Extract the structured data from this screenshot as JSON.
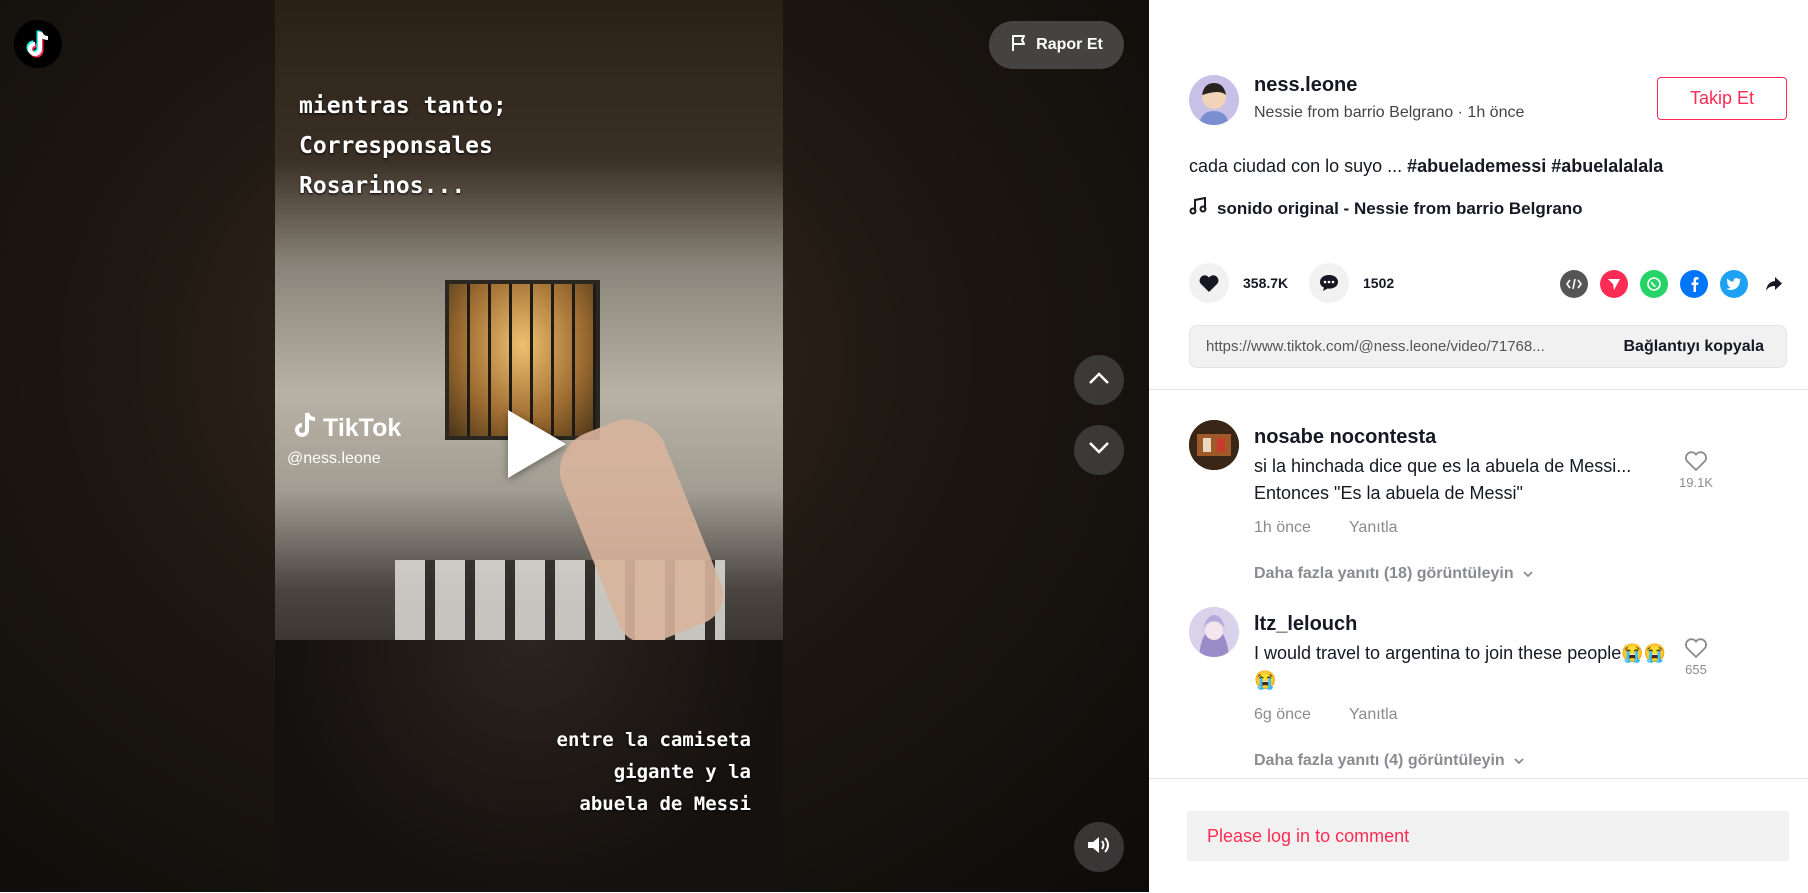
{
  "header": {
    "report_label": "Rapor Et"
  },
  "video": {
    "overlay_top": "mientras tanto;\nCorresponsales\nRosarinos...",
    "overlay_bottom": "entre la camiseta\ngigante y la\nabuela de Messi",
    "watermark_brand": "TikTok",
    "watermark_user": "@ness.leone"
  },
  "author": {
    "username": "ness.leone",
    "display_name": "Nessie from barrio Belgrano",
    "time": "1h önce",
    "follow_label": "Takip Et"
  },
  "post": {
    "description": "cada ciudad con lo suyo ...",
    "hashtags": [
      "#abuelademessi",
      "#abuelalalala"
    ],
    "music": "sonido original - Nessie from barrio Belgrano",
    "likes": "358.7K",
    "comments": "1502",
    "link": "https://www.tiktok.com/@ness.leone/video/71768...",
    "copy_label": "Bağlantıyı kopyala"
  },
  "share_icons": [
    "embed-icon",
    "send-icon",
    "whatsapp-icon",
    "facebook-icon",
    "twitter-icon",
    "share-arrow-icon"
  ],
  "comments": [
    {
      "user": "nosabe nocontesta",
      "text": "si la hinchada dice que es la abuela de Messi...\nEntonces \"Es la abuela de Messi\"",
      "time": "1h önce",
      "reply": "Yanıtla",
      "likes": "19.1K",
      "more": "Daha fazla yanıtı (18) görüntüleyin"
    },
    {
      "user": "ltz_lelouch",
      "text": "I would travel to argentina to join these people😭😭\n😭",
      "time": "6g önce",
      "reply": "Yanıtla",
      "likes": "655",
      "more": "Daha fazla yanıtı (4) görüntüleyin"
    }
  ],
  "login_prompt": "Please log in to comment",
  "colors": {
    "accent": "#fe2c55",
    "text": "#161823",
    "muted": "#8a8b91"
  }
}
